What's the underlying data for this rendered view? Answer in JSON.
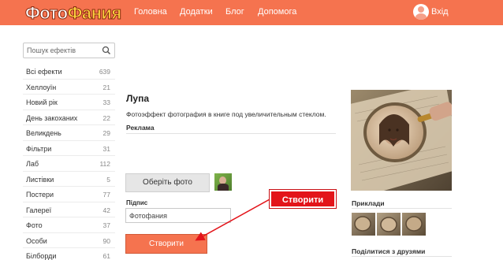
{
  "header": {
    "logo_part1": "Фото",
    "logo_part2": "Фания",
    "nav": [
      "Головна",
      "Додатки",
      "Блог",
      "Допомога"
    ],
    "login": "Вхід",
    "color": "#f5734f"
  },
  "sidebar": {
    "search_placeholder": "Пошук ефектів",
    "categories": [
      {
        "label": "Всі ефекти",
        "count": "639"
      },
      {
        "label": "Хеллоуїн",
        "count": "21"
      },
      {
        "label": "Новий рік",
        "count": "33"
      },
      {
        "label": "День закоханих",
        "count": "22"
      },
      {
        "label": "Великдень",
        "count": "29"
      },
      {
        "label": "Фільтри",
        "count": "31"
      },
      {
        "label": "Лаб",
        "count": "112"
      },
      {
        "label": "Листівки",
        "count": "5"
      },
      {
        "label": "Постери",
        "count": "77"
      },
      {
        "label": "Галереї",
        "count": "42"
      },
      {
        "label": "Фото",
        "count": "37"
      },
      {
        "label": "Особи",
        "count": "90"
      },
      {
        "label": "Білборди",
        "count": "61"
      }
    ]
  },
  "main": {
    "title": "Лупа",
    "description": "Фотоэффект фотография в книге под увеличительным стеклом.",
    "ads_label": "Реклама",
    "choose_button": "Оберіть фото",
    "sign_label": "Підпис",
    "sign_value": "Фотофания",
    "create_button": "Створити"
  },
  "callout": {
    "text": "Створити",
    "color": "#e3141a"
  },
  "right": {
    "examples_label": "Приклади",
    "share_label": "Поділитися з друзями"
  }
}
